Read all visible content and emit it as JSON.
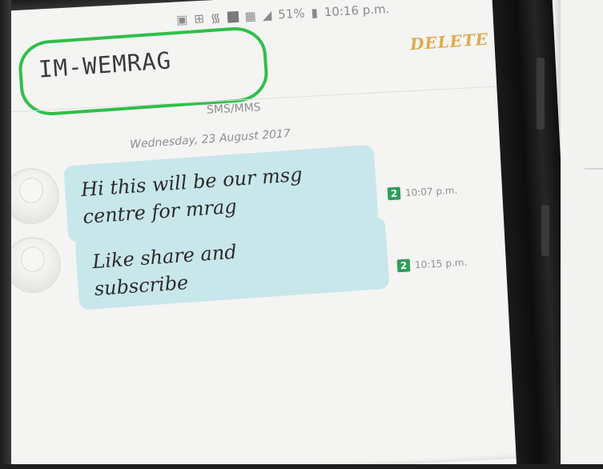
{
  "status_bar": {
    "signal_text": "51%",
    "time_text": "10:16 p.m."
  },
  "header": {
    "contact_name": "IM-WEMRAG",
    "delete_label": "DELETE",
    "back_icon": "chevron-left-icon"
  },
  "thread": {
    "type_label": "SMS/MMS",
    "date_label": "Wednesday, 23 August 2017"
  },
  "messages": [
    {
      "lines": [
        "Hi this will be our msg",
        "centre for mrag"
      ],
      "sim_badge": "2",
      "time": "10:07 p.m."
    },
    {
      "lines": [
        "Like share and",
        "subscribe"
      ],
      "sim_badge": "2",
      "time": "10:15 p.m."
    }
  ],
  "colors": {
    "accent": "#e0a94a",
    "bubble": "#c8e7ea",
    "annotation_circle": "#2fbf4a",
    "sim_badge": "#2e9e5b"
  }
}
